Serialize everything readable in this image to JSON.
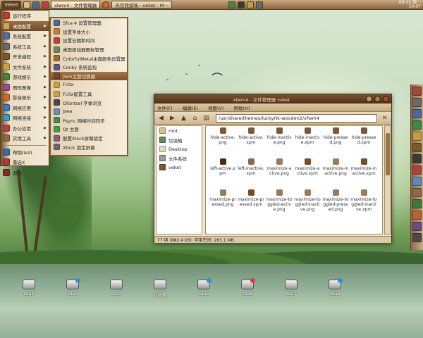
{
  "panel": {
    "start_label": "Veket",
    "tasks": [
      "xlwm4 - 文件管理器",
      "天空竞技场 - veket - M···"
    ],
    "clock_line1": "06-13 周一",
    "clock_line2": "14:07"
  },
  "launcher": {
    "items": [
      {
        "label": "运行程序",
        "color": "#c73b2a",
        "arrow": false
      },
      {
        "label": "桌面配置",
        "color": "#d2a44a",
        "arrow": true
      },
      {
        "label": "系统配置",
        "color": "#4d6fa0",
        "arrow": true
      },
      {
        "label": "系统工具",
        "color": "#6a6a6a",
        "arrow": true
      },
      {
        "label": "开发编程",
        "color": "#7a5a30",
        "arrow": true
      },
      {
        "label": "文件系统",
        "color": "#d0a040",
        "arrow": true
      },
      {
        "label": "游戏娱乐",
        "color": "#3f8a3a",
        "arrow": true
      },
      {
        "label": "图形图像",
        "color": "#a04a8a",
        "arrow": true
      },
      {
        "label": "影音娱乐",
        "color": "#d06a2a",
        "arrow": true
      },
      {
        "label": "网络应用",
        "color": "#3a7ac0",
        "arrow": true
      },
      {
        "label": "网络连接",
        "color": "#3a9ac0",
        "arrow": true
      },
      {
        "label": "办公应用",
        "color": "#c04040",
        "arrow": true
      },
      {
        "label": "实用工具",
        "color": "#8a6a3a",
        "arrow": true
      }
    ],
    "bottom_items": [
      {
        "label": "帮助(&X)",
        "color": "#3a6ab0"
      },
      {
        "label": "重启X",
        "color": "#b03a3a"
      },
      {
        "label": "退出",
        "color": "#8a2a2a"
      }
    ],
    "selected_index": 1
  },
  "submenu": {
    "items": [
      {
        "label": "Sfce 4 设置管理器",
        "color": "#4a6a9a"
      },
      {
        "label": "设置字体大小",
        "color": "#c08040"
      },
      {
        "label": "设置日期和时间",
        "color": "#c04040"
      },
      {
        "label": "桌面驱动器图标管理",
        "color": "#6a8a5a"
      },
      {
        "label": "ColorfulMetal主题颜色设置器",
        "color": "#a06a30"
      },
      {
        "label": "Conky 系统监视",
        "color": "#5a5a8a"
      },
      {
        "label": "Jwm主题切换器",
        "color": "#7a4a2a"
      },
      {
        "label": "Fcitx",
        "color": "#d0a040"
      },
      {
        "label": "Fcitx配置工具",
        "color": "#d0a040"
      },
      {
        "label": "Gfontsel 字体浏览",
        "color": "#4a4a4a"
      },
      {
        "label": "Jsea",
        "color": "#6a8ac0"
      },
      {
        "label": "Psync 网络时间同步",
        "color": "#4a8a4a"
      },
      {
        "label": "Qt 主题",
        "color": "#3aa04a"
      },
      {
        "label": "配置Xlock屏幕锁定",
        "color": "#8a5a8a"
      },
      {
        "label": "Xlock 锁定屏幕",
        "color": "#6a6a6a"
      }
    ],
    "selected_index": 6
  },
  "window": {
    "title": "xlwm4 - 文件管理器 veket",
    "menus": [
      "文件(F)",
      "编辑(E)",
      "视图(V)",
      "帮助(H)"
    ],
    "path": "/usr/share/themes/luckyHk-wooden2/xfwm4",
    "places": [
      {
        "label": "root",
        "color": "#d8c090"
      },
      {
        "label": "垃圾桶",
        "color": "#6a8a5a"
      },
      {
        "label": "Desktop",
        "color": "#e8dcc0"
      },
      {
        "label": "文件系统",
        "color": "#9a9a9a"
      },
      {
        "label": "veket",
        "color": "#7a5a30"
      }
    ],
    "files": [
      {
        "name": "hide-active.png",
        "icon": "#7a5a3a"
      },
      {
        "name": "hide-active.xpm",
        "icon": "#7a5a3a"
      },
      {
        "name": "hide-inactive.png",
        "icon": "#7a5a3a"
      },
      {
        "name": "hide-inactive.xpm",
        "icon": "#7a5a3a"
      },
      {
        "name": "hide-pressed.png",
        "icon": "#7a5a3a"
      },
      {
        "name": "hide-pressed.xpm",
        "icon": "#7a5a3a"
      },
      {
        "name": "left-active.xpm",
        "icon": "#4a2a10"
      },
      {
        "name": "left-inactive.xpm",
        "icon": "#8a6a4a"
      },
      {
        "name": "maximize-active.png",
        "icon": "#9a7a5a"
      },
      {
        "name": "maximize-active.xpm",
        "icon": "#7a4a20"
      },
      {
        "name": "maximize-inactive.png",
        "icon": "#9a7a5a"
      },
      {
        "name": "maximize-inactive.xpm",
        "icon": "#7a4a20"
      },
      {
        "name": "maximize-pressed.png",
        "icon": "#9a7a5a"
      },
      {
        "name": "maximize-pressed.xpm",
        "icon": "#7a4a20"
      },
      {
        "name": "maximize-toggled-active.png",
        "icon": "#9a7a5a"
      },
      {
        "name": "maximize-toggled-inactive.png",
        "icon": "#9a7a5a"
      },
      {
        "name": "maximize-toggled-pressed.png",
        "icon": "#9a7a5a"
      },
      {
        "name": "maximize-toggled-inactive.xpm",
        "icon": "#9a7a5a"
      }
    ],
    "status": "77 项 (882.4 kB), 可用空间: 263.1 MB"
  },
  "desktop_drives": [
    {
      "label": "sda1",
      "dot": ""
    },
    {
      "label": "sda2",
      "dot": "#3a8ae0"
    },
    {
      "label": "sda3",
      "dot": ""
    },
    {
      "label": "垃圾桶",
      "dot": ""
    },
    {
      "label": "sda5",
      "dot": "#3a8ae0"
    },
    {
      "label": "sda6",
      "dot": "#e03a3a"
    },
    {
      "label": "sda7",
      "dot": ""
    },
    {
      "label": "sda8",
      "dot": "#3a8ae0"
    }
  ],
  "dock_icons": [
    "#a04a3a",
    "#6a6a6a",
    "#4a6a9a",
    "#3a8a4a",
    "#c0a040",
    "#7a5a30",
    "#3a3a3a",
    "#b04040",
    "#5a8ac0",
    "#8a6a4a",
    "#3a7a3a",
    "#c06030",
    "#6a4a8a",
    "#4a4a4a"
  ]
}
